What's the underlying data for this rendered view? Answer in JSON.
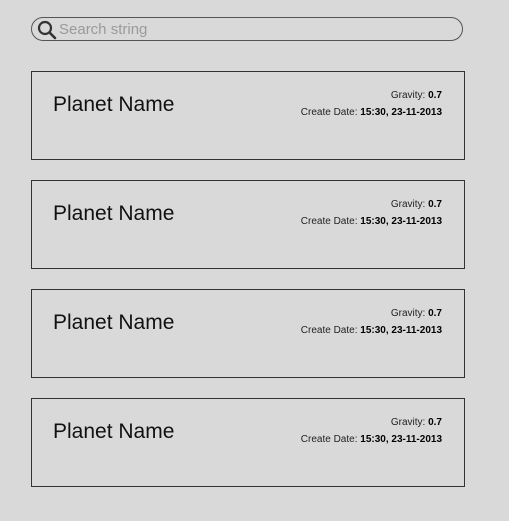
{
  "search": {
    "placeholder": "Search string",
    "icon": "search-icon"
  },
  "planets": [
    {
      "name": "Planet Name",
      "gravity_label": "Gravity:",
      "gravity_value": "0.7",
      "create_date_label": "Create Date:",
      "create_date_value": "15:30, 23-11-2013"
    },
    {
      "name": "Planet Name",
      "gravity_label": "Gravity:",
      "gravity_value": "0.7",
      "create_date_label": "Create Date:",
      "create_date_value": "15:30, 23-11-2013"
    },
    {
      "name": "Planet Name",
      "gravity_label": "Gravity:",
      "gravity_value": "0.7",
      "create_date_label": "Create Date:",
      "create_date_value": "15:30, 23-11-2013"
    },
    {
      "name": "Planet Name",
      "gravity_label": "Gravity:",
      "gravity_value": "0.7",
      "create_date_label": "Create Date:",
      "create_date_value": "15:30, 23-11-2013"
    }
  ]
}
